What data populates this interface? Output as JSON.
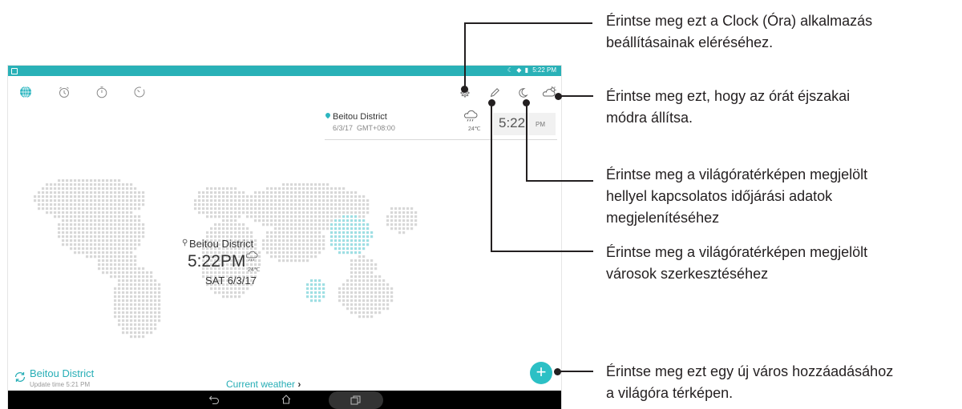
{
  "status": {
    "time": "5:22 PM"
  },
  "toolbar": {
    "tabs": [
      "world-clock",
      "alarm",
      "stopwatch",
      "timer"
    ],
    "actions": [
      "settings",
      "edit",
      "night-mode",
      "weather"
    ],
    "accent_color": "#29b1b7"
  },
  "location": {
    "name": "Beitou District",
    "date": "6/3/17",
    "timezone": "GMT+08:00",
    "temp": "24℃",
    "time": "5:22",
    "ampm": "PM"
  },
  "map_label": {
    "city": "Beitou District",
    "time": "5:22PM",
    "temp": "24℃",
    "date": "SAT 6/3/17"
  },
  "bottom": {
    "city": "Beitou District",
    "update_time": "Update time 5:21 PM",
    "current_weather": "Current weather"
  },
  "callouts": {
    "settings": [
      "Érintse meg ezt a Clock (Óra) alkalmazás",
      "beállításainak eléréséhez."
    ],
    "night": [
      "Érintse meg ezt, hogy az órát éjszakai",
      "módra állítsa."
    ],
    "weather": [
      "Érintse meg a világóratérképen megjelölt",
      "hellyel kapcsolatos időjárási adatok",
      "megjelenítéséhez"
    ],
    "edit": [
      "Érintse meg a világóratérképen megjelölt",
      "városok szerkesztéséhez"
    ],
    "add": [
      "Érintse meg ezt egy új város hozzáadásához",
      "a világóra térképen."
    ]
  }
}
